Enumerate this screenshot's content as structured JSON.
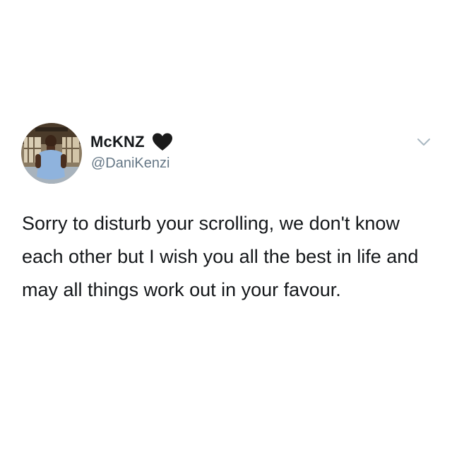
{
  "tweet": {
    "author": {
      "display_name": "McKNZ",
      "handle": "@DaniKenzi",
      "badge_icon": "black-heart-icon",
      "avatar": "profile-photo"
    },
    "text": "Sorry to disturb your scrolling, we don't know each other but I wish you all the best in life and may all things work out in your favour.",
    "menu_icon": "chevron-down-icon"
  },
  "colors": {
    "text": "#14171a",
    "handle": "#657786",
    "chevron": "#aab8c2",
    "background": "#ffffff"
  }
}
